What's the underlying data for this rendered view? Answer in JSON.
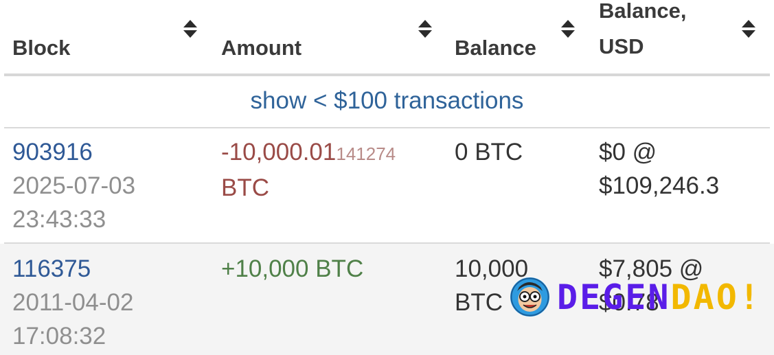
{
  "table": {
    "columns": [
      {
        "label_line1": "",
        "label_line2": "Block"
      },
      {
        "label_line1": "",
        "label_line2": "Amount"
      },
      {
        "label_line1": "",
        "label_line2": "Balance"
      },
      {
        "label_line1": "Balance,",
        "label_line2": "USD"
      }
    ],
    "filter_link": "show < $100 transactions",
    "rows": [
      {
        "block": "903916",
        "date": "2025-07-03",
        "time": "23:43:33",
        "amount_main": "-10,000.01",
        "amount_small": "141274",
        "amount_unit": "BTC",
        "amount_sign": "negative",
        "balance_line1": "0 BTC",
        "balance_line2": "",
        "usd_line1": "$0 @",
        "usd_line2": "$109,246.3"
      },
      {
        "block": "116375",
        "date": "2011-04-02",
        "time": "17:08:32",
        "amount_main": "+10,000 BTC",
        "amount_sign": "positive",
        "balance_line1": "10,000",
        "balance_line2": "BTC",
        "usd_line1": "$7,805 @",
        "usd_line2": "$0.78"
      }
    ]
  },
  "watermark": {
    "text_part1": "DEGEN",
    "text_part2": "DAO!",
    "colors": {
      "part1": "#5a1de8",
      "part2": "#f2b800",
      "logo_bg": "#2e9be0"
    },
    "icon": "cartoon-face-logo"
  },
  "colors": {
    "link": "#2f6399",
    "negative": "#9a4b47",
    "positive": "#4f8048",
    "muted": "#8f8f8f",
    "alt_row_bg": "#f4f4f4"
  }
}
